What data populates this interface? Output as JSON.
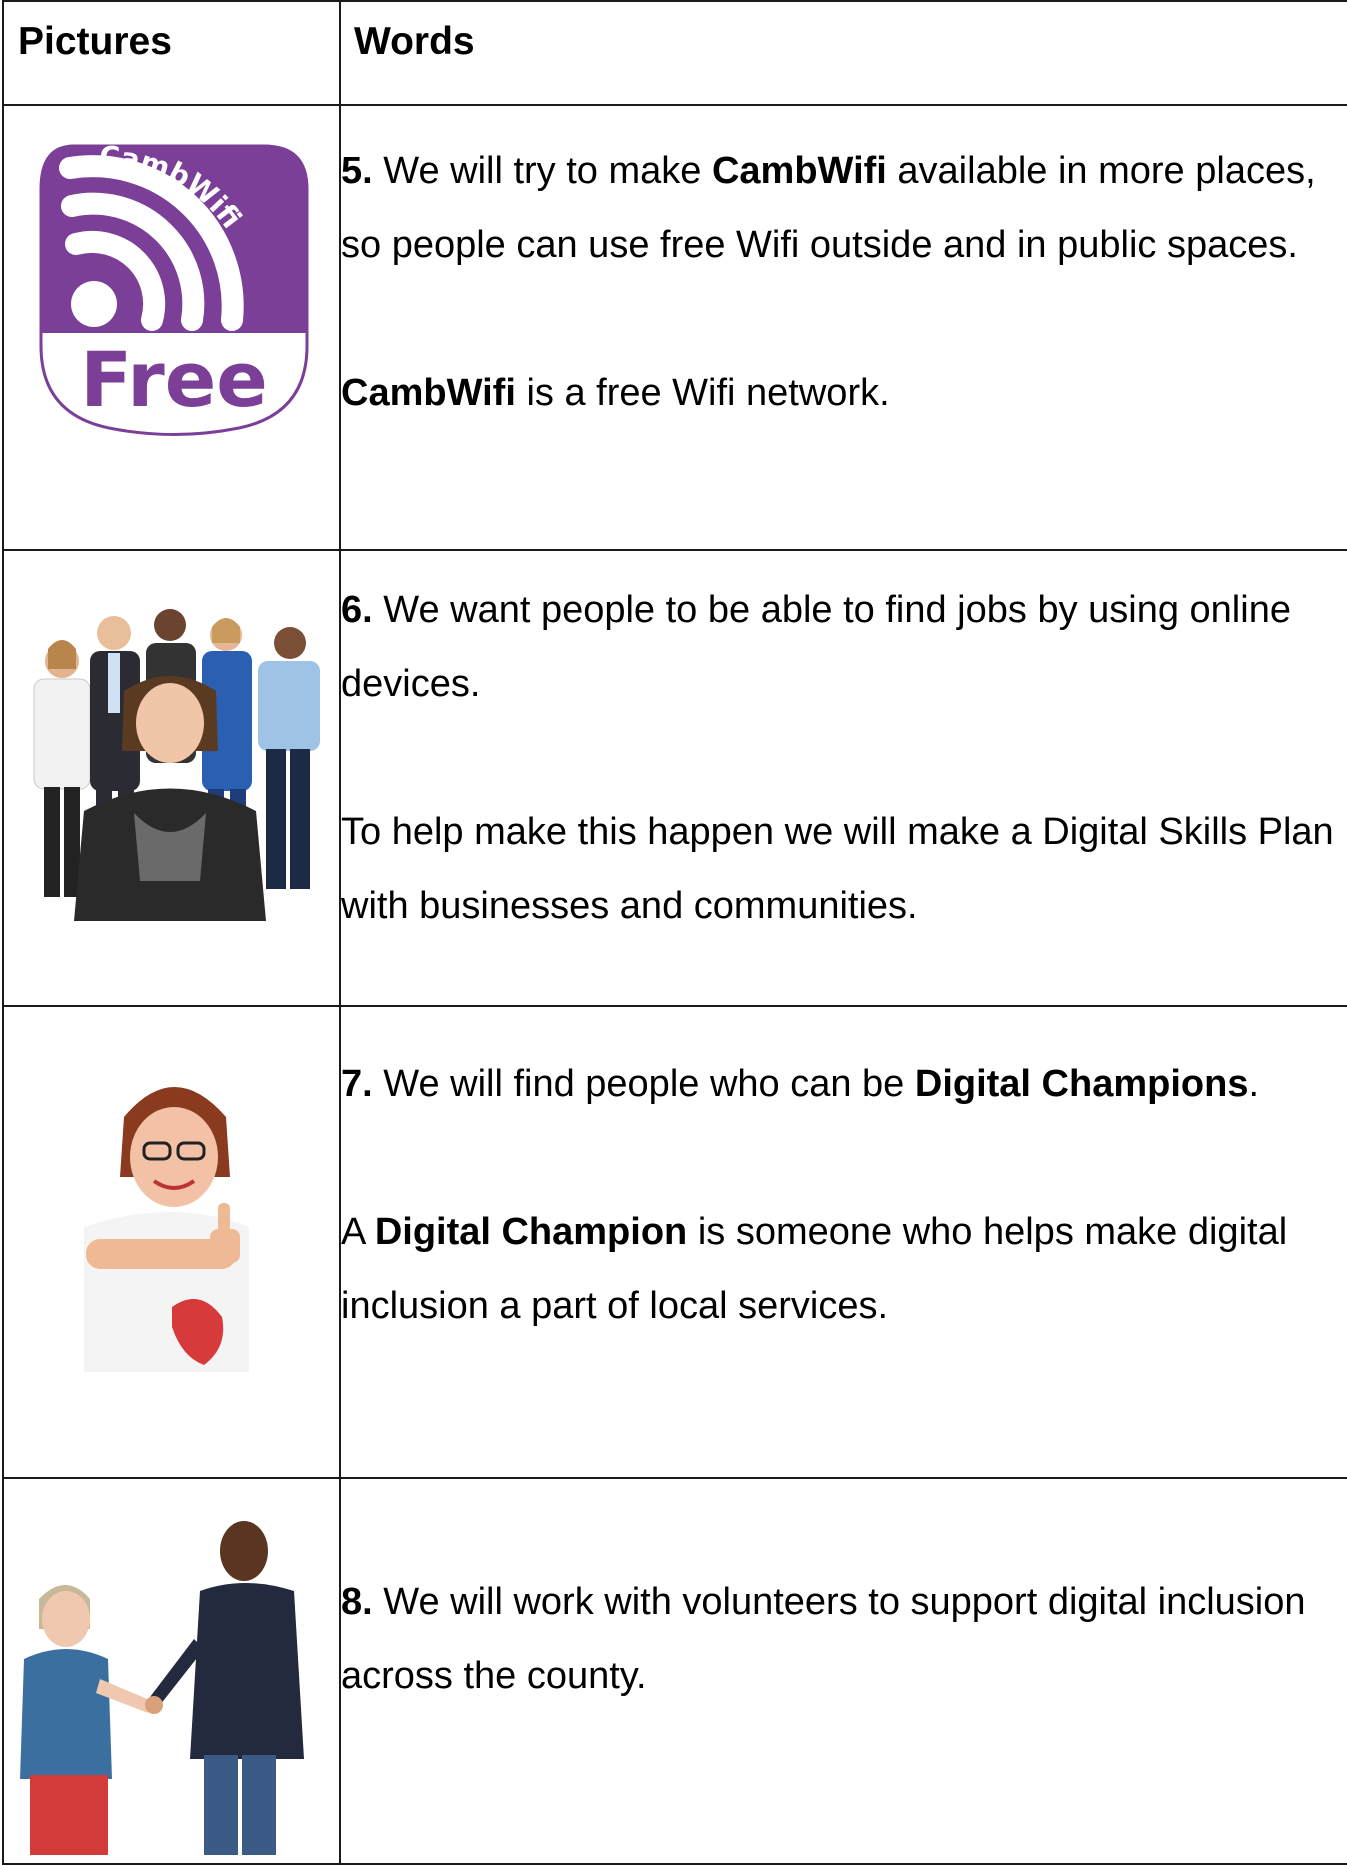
{
  "header": {
    "col_pictures": "Pictures",
    "col_words": "Words"
  },
  "logo": {
    "arc_text": "CambWifi",
    "badge_text": "Free",
    "color": "#7B3F98"
  },
  "rows": [
    {
      "num": "5.",
      "p1": {
        "a": " We will try to make ",
        "b": "CambWifi",
        "c": " available in more places, so people can use free Wifi outside and in public spaces."
      },
      "p2": {
        "b": "CambWifi",
        "c": " is a free Wifi network."
      }
    },
    {
      "num": "6.",
      "p1": {
        "a": " We want people to be able to find jobs by using online devices."
      },
      "p2": {
        "c": "To help make this happen we will make a Digital Skills Plan with businesses and communities."
      }
    },
    {
      "num": "7.",
      "p1": {
        "a": " We will find people who can be ",
        "b": "Digital Champions",
        "c": "."
      },
      "p2": {
        "a": "A ",
        "b": "Digital Champion",
        "c": " is someone who helps make digital inclusion a part of local services."
      }
    },
    {
      "num": "8.",
      "p1": {
        "a": " We will work with volunteers to support digital inclusion across the county."
      }
    }
  ]
}
